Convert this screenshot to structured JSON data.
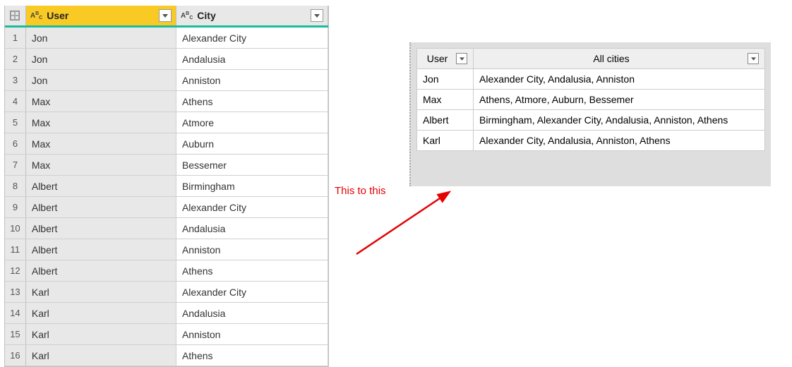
{
  "source_table": {
    "columns": {
      "user_label": "User",
      "city_label": "City"
    },
    "rows": [
      {
        "num": "1",
        "user": "Jon",
        "city": "Alexander City"
      },
      {
        "num": "2",
        "user": "Jon",
        "city": "Andalusia"
      },
      {
        "num": "3",
        "user": "Jon",
        "city": "Anniston"
      },
      {
        "num": "4",
        "user": "Max",
        "city": "Athens"
      },
      {
        "num": "5",
        "user": "Max",
        "city": "Atmore"
      },
      {
        "num": "6",
        "user": "Max",
        "city": "Auburn"
      },
      {
        "num": "7",
        "user": "Max",
        "city": "Bessemer"
      },
      {
        "num": "8",
        "user": "Albert",
        "city": "Birmingham"
      },
      {
        "num": "9",
        "user": "Albert",
        "city": "Alexander City"
      },
      {
        "num": "10",
        "user": "Albert",
        "city": "Andalusia"
      },
      {
        "num": "11",
        "user": "Albert",
        "city": "Anniston"
      },
      {
        "num": "12",
        "user": "Albert",
        "city": "Athens"
      },
      {
        "num": "13",
        "user": "Karl",
        "city": "Alexander City"
      },
      {
        "num": "14",
        "user": "Karl",
        "city": "Andalusia"
      },
      {
        "num": "15",
        "user": "Karl",
        "city": "Anniston"
      },
      {
        "num": "16",
        "user": "Karl",
        "city": "Athens"
      }
    ]
  },
  "annotation": {
    "text": "This to this"
  },
  "result_table": {
    "columns": {
      "user_label": "User",
      "allcities_label": "All cities"
    },
    "rows": [
      {
        "user": "Jon",
        "cities": "Alexander City, Andalusia, Anniston"
      },
      {
        "user": "Max",
        "cities": "Athens, Atmore, Auburn, Bessemer"
      },
      {
        "user": "Albert",
        "cities": "Birmingham, Alexander City, Andalusia, Anniston, Athens"
      },
      {
        "user": "Karl",
        "cities": "Alexander City, Andalusia, Anniston, Athens"
      }
    ]
  }
}
